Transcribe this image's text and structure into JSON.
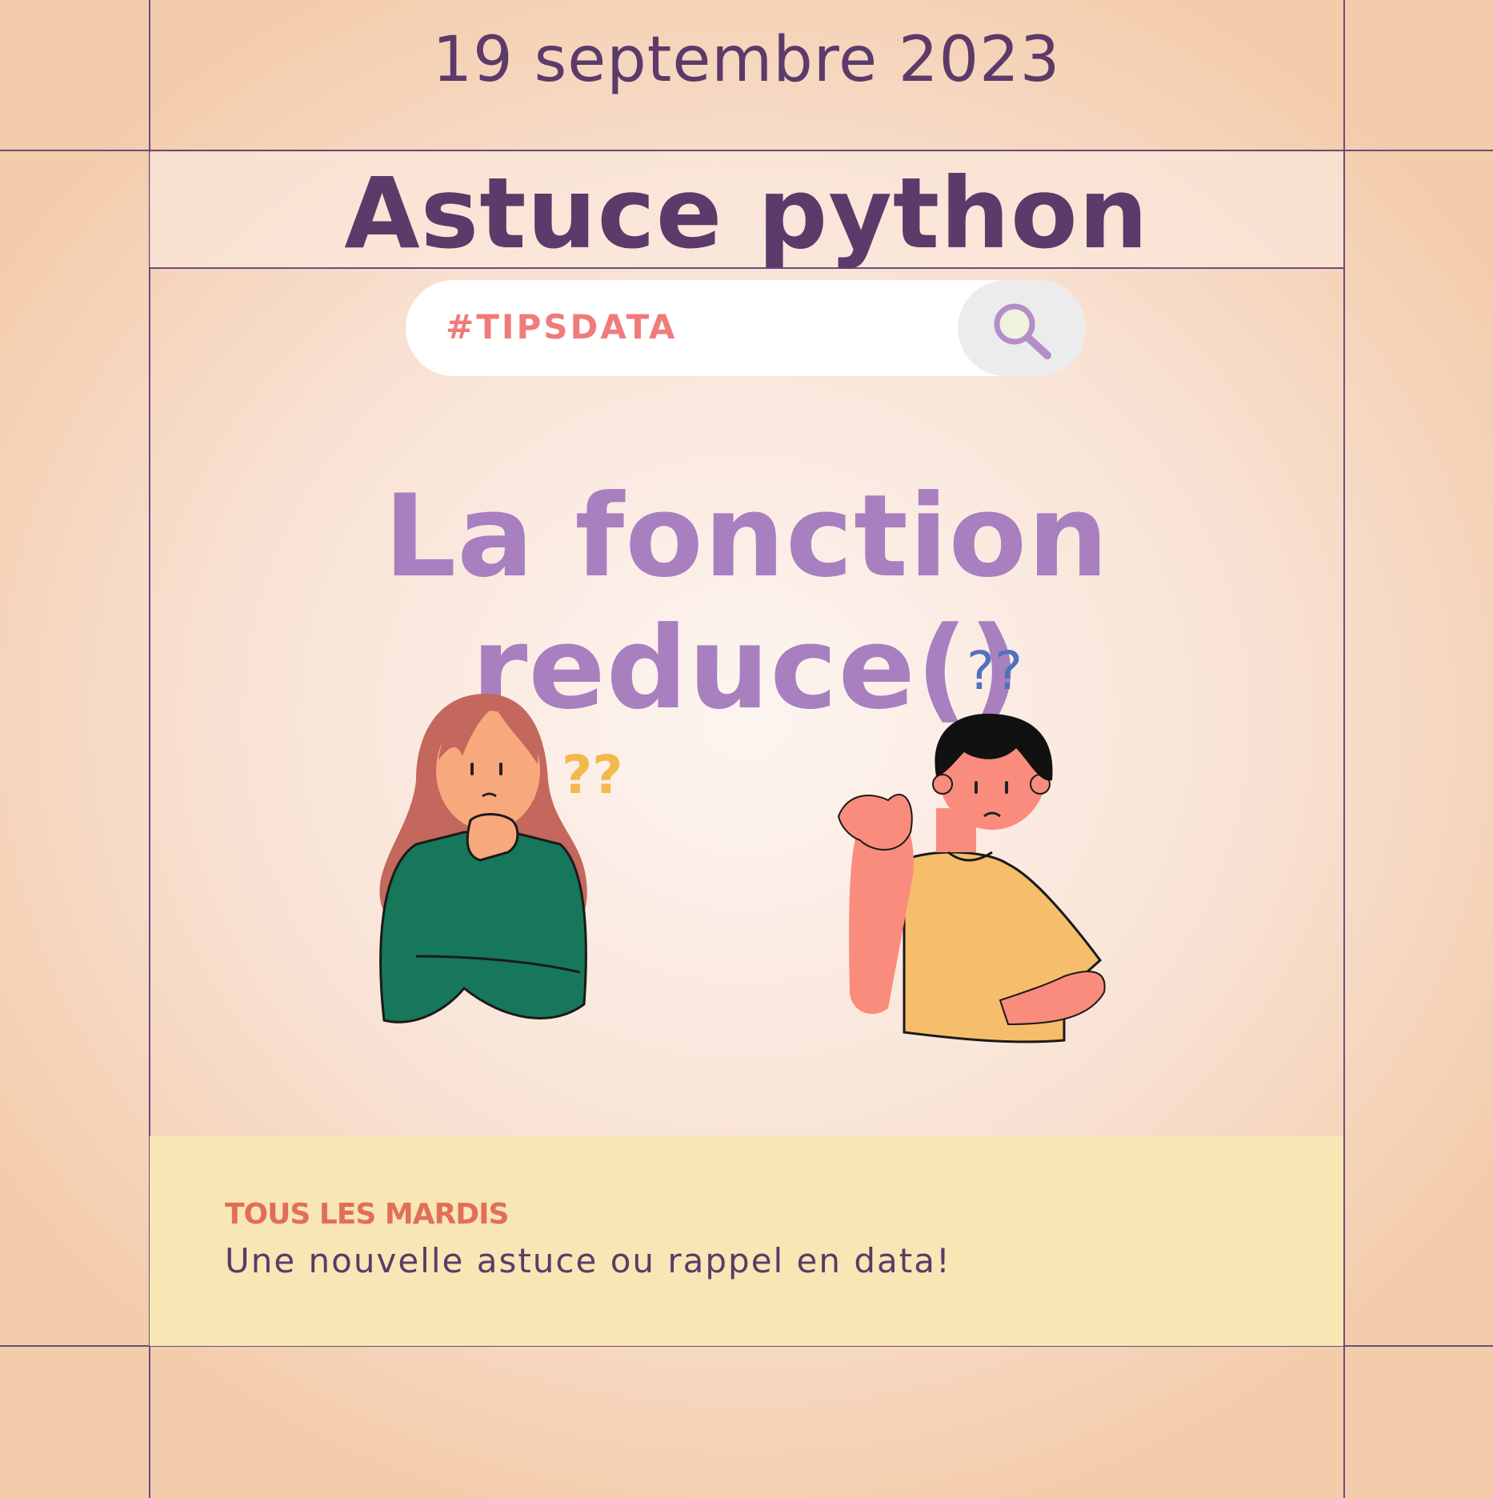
{
  "header": {
    "date": "19 septembre 2023"
  },
  "title": "Astuce python",
  "search": {
    "hashtag": "#TIPSDATA",
    "icon": "search-icon"
  },
  "headline": "La fonction reduce()",
  "illustrations": {
    "woman_marks": "??",
    "man_marks": "??"
  },
  "footer": {
    "label": "TOUS LES MARDIS",
    "text": "Une nouvelle astuce ou rappel en data!"
  },
  "colors": {
    "purple_dark": "#5c3a69",
    "purple_light": "#a87fbf",
    "coral": "#f07b7b",
    "yellow_band": "#f8e6b4"
  }
}
